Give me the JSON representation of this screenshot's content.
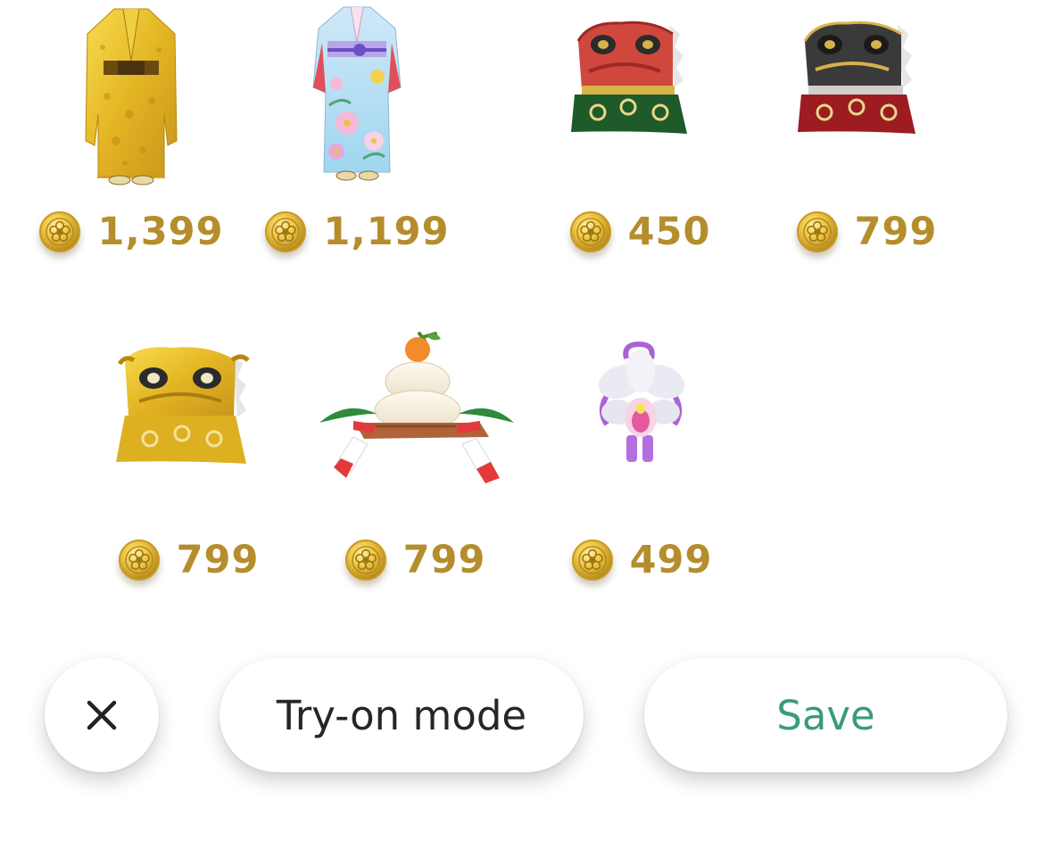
{
  "items": [
    {
      "name": "Gold kimono",
      "price": "1,399"
    },
    {
      "name": "Floral kimono",
      "price": "1,199"
    },
    {
      "name": "Red lion dance hat",
      "price": "450"
    },
    {
      "name": "Black lion dance hat",
      "price": "799"
    },
    {
      "name": "Gold lion dance hat",
      "price": "799"
    },
    {
      "name": "Kagami mochi",
      "price": "799"
    },
    {
      "name": "Orchid hair ornament",
      "price": "499"
    }
  ],
  "currency_icon": "coin-icon",
  "colors": {
    "price": "#b58d2c",
    "save": "#3a9a7e",
    "coin": "#e0b431",
    "text": "#262626"
  },
  "footer": {
    "close_icon": "close-icon",
    "try_on_label": "Try-on mode",
    "save_label": "Save"
  }
}
